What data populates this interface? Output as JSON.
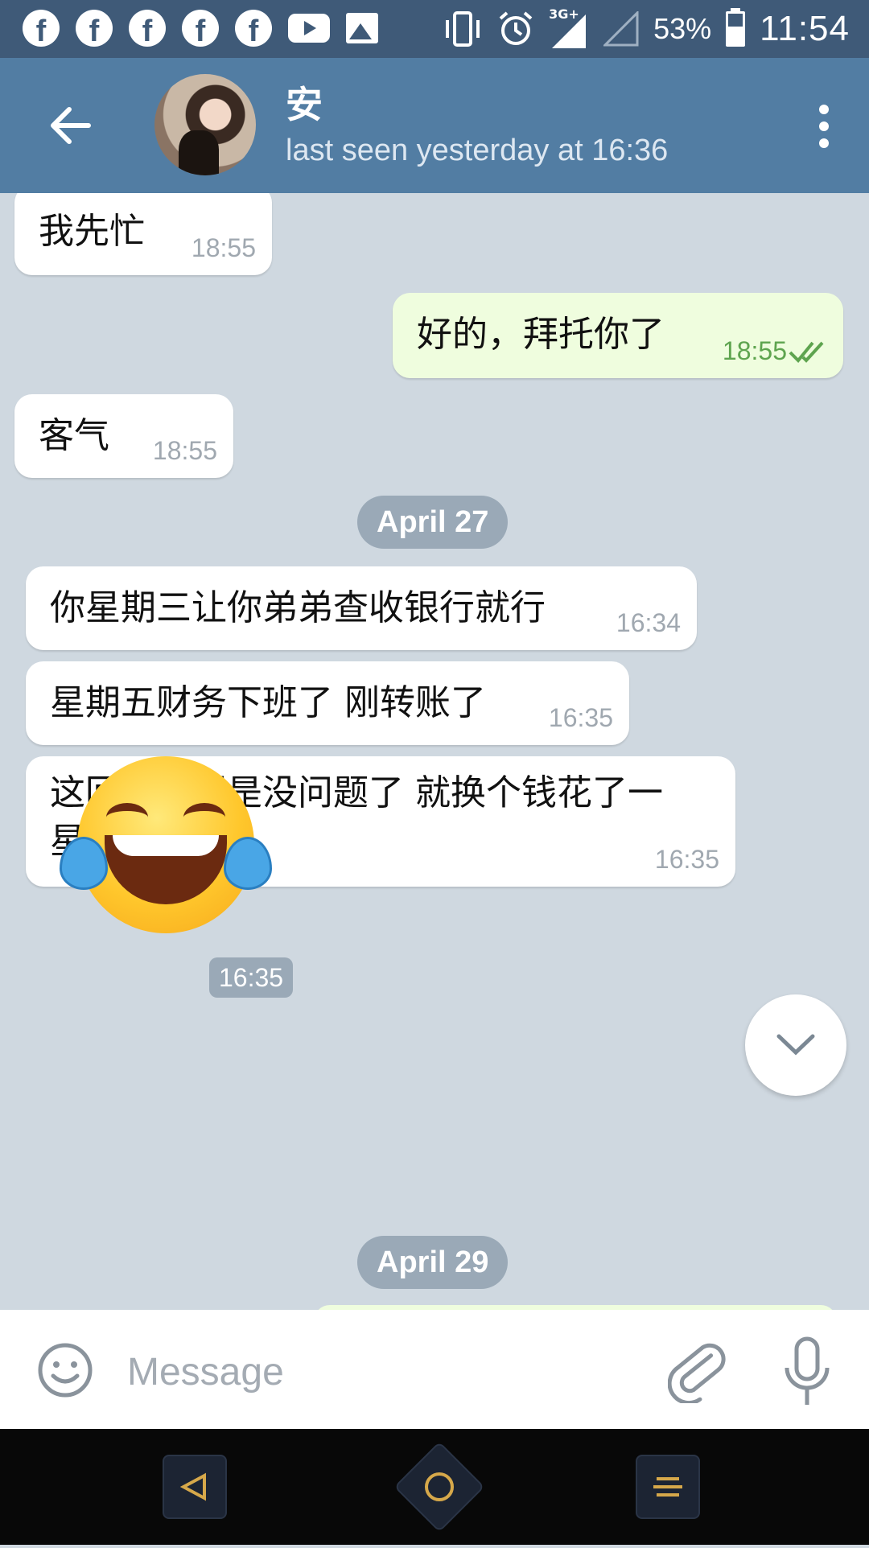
{
  "status_bar": {
    "network": "3G+",
    "battery": "53%",
    "time": "11:54",
    "notification_icons": [
      "facebook-icon",
      "facebook-icon",
      "facebook-icon",
      "facebook-icon",
      "facebook-icon",
      "youtube-icon",
      "gallery-icon"
    ]
  },
  "header": {
    "name": "安",
    "status": "last seen yesterday at 16:36"
  },
  "messages": [
    {
      "direction": "in",
      "text": "我先忙",
      "time": "18:55"
    },
    {
      "direction": "out",
      "text": "好的，拜托你了",
      "time": "18:55",
      "read": true
    },
    {
      "direction": "in",
      "text": "客气",
      "time": "18:55"
    },
    {
      "direction": "in",
      "text": "你星期三让你弟弟查收银行就行",
      "time": "16:34"
    },
    {
      "direction": "in",
      "text": "星期五财务下班了 刚转账了",
      "time": "16:35"
    },
    {
      "direction": "in",
      "text": "这回儿希望是没问题了 就换个钱花了一\n星期",
      "time": "16:35"
    }
  ],
  "dates": [
    "April 27",
    "April 29"
  ],
  "sticker": {
    "emoji": "😂",
    "time": "16:35"
  },
  "input": {
    "placeholder": "Message",
    "value": ""
  },
  "colors": {
    "header_bg": "#527da3",
    "status_bar_bg": "#3f5a78",
    "chat_bg": "#cfd8e0",
    "out_bubble": "#effdde",
    "out_time": "#5ea44f",
    "date_pill": "#9aa9b7"
  }
}
